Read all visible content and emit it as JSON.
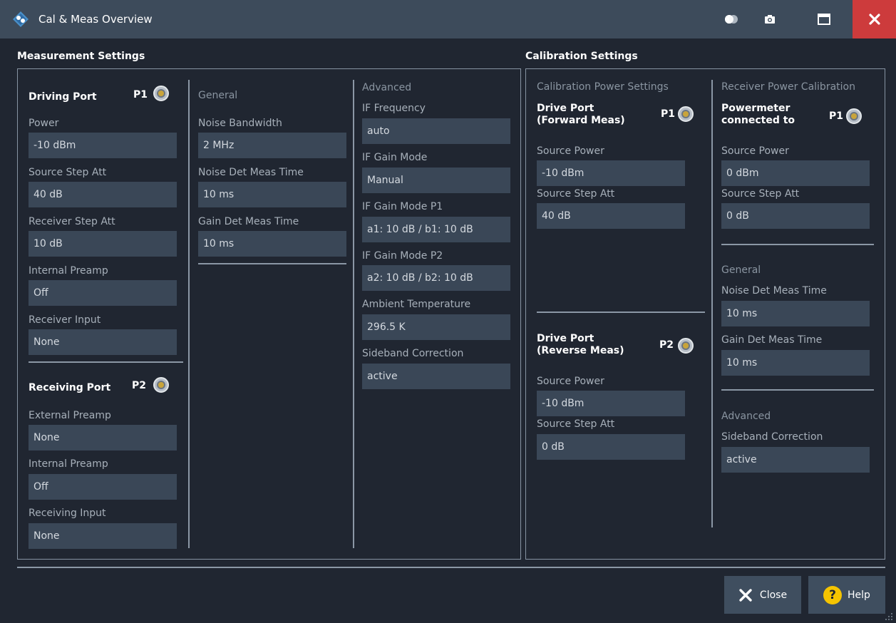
{
  "window": {
    "title": "Cal & Meas Overview"
  },
  "measurement": {
    "title": "Measurement Settings",
    "driving_port": {
      "name": "Driving Port",
      "port": "P1",
      "fields": [
        {
          "label": "Power",
          "value": "-10 dBm"
        },
        {
          "label": "Source Step Att",
          "value": "40 dB"
        },
        {
          "label": "Receiver Step Att",
          "value": "10 dB"
        },
        {
          "label": "Internal Preamp",
          "value": "Off"
        },
        {
          "label": "Receiver Input",
          "value": "None"
        }
      ]
    },
    "receiving_port": {
      "name": "Receiving Port",
      "port": "P2",
      "fields": [
        {
          "label": "External Preamp",
          "value": "None"
        },
        {
          "label": "Internal Preamp",
          "value": "Off"
        },
        {
          "label": "Receiving Input",
          "value": "None"
        }
      ]
    },
    "general": {
      "header": "General",
      "fields": [
        {
          "label": "Noise Bandwidth",
          "value": "2 MHz"
        },
        {
          "label": "Noise Det Meas Time",
          "value": "10 ms"
        },
        {
          "label": "Gain Det Meas Time",
          "value": "10 ms"
        }
      ]
    },
    "advanced": {
      "header": "Advanced",
      "fields": [
        {
          "label": "IF Frequency",
          "value": "auto"
        },
        {
          "label": "IF Gain Mode",
          "value": "Manual"
        },
        {
          "label": "IF Gain Mode P1",
          "value": "a1: 10 dB / b1: 10 dB"
        },
        {
          "label": "IF Gain Mode P2",
          "value": "a2: 10 dB / b2: 10 dB"
        },
        {
          "label": "Ambient Temperature",
          "value": "296.5 K"
        },
        {
          "label": "Sideband Correction",
          "value": "active"
        }
      ]
    }
  },
  "calibration": {
    "title": "Calibration Settings",
    "power_settings": {
      "header": "Calibration Power Settings",
      "forward": {
        "name_line1": "Drive Port",
        "name_line2": "(Forward Meas)",
        "port": "P1",
        "fields": [
          {
            "label": "Source Power",
            "value": "-10 dBm"
          },
          {
            "label": "Source Step Att",
            "value": "40 dB"
          }
        ]
      },
      "reverse": {
        "name_line1": "Drive Port",
        "name_line2": "(Reverse Meas)",
        "port": "P2",
        "fields": [
          {
            "label": "Source Power",
            "value": "-10 dBm"
          },
          {
            "label": "Source Step Att",
            "value": "0 dB"
          }
        ]
      }
    },
    "receiver": {
      "header": "Receiver Power Calibration",
      "name_line1": "Powermeter",
      "name_line2": "connected to",
      "port": "P1",
      "fields": [
        {
          "label": "Source Power",
          "value": "0 dBm"
        },
        {
          "label": "Source Step Att",
          "value": "0 dB"
        }
      ],
      "general": {
        "header": "General",
        "fields": [
          {
            "label": "Noise Det Meas Time",
            "value": "10 ms"
          },
          {
            "label": "Gain Det Meas Time",
            "value": "10 ms"
          }
        ]
      },
      "advanced": {
        "header": "Advanced",
        "fields": [
          {
            "label": "Sideband Correction",
            "value": "active"
          }
        ]
      }
    }
  },
  "buttons": {
    "close": "Close",
    "help": "Help",
    "help_glyph": "?"
  },
  "colors": {
    "accent_close": "#cd3b3c",
    "help_icon": "#f5c400",
    "port_connector": "#c9a43a"
  }
}
